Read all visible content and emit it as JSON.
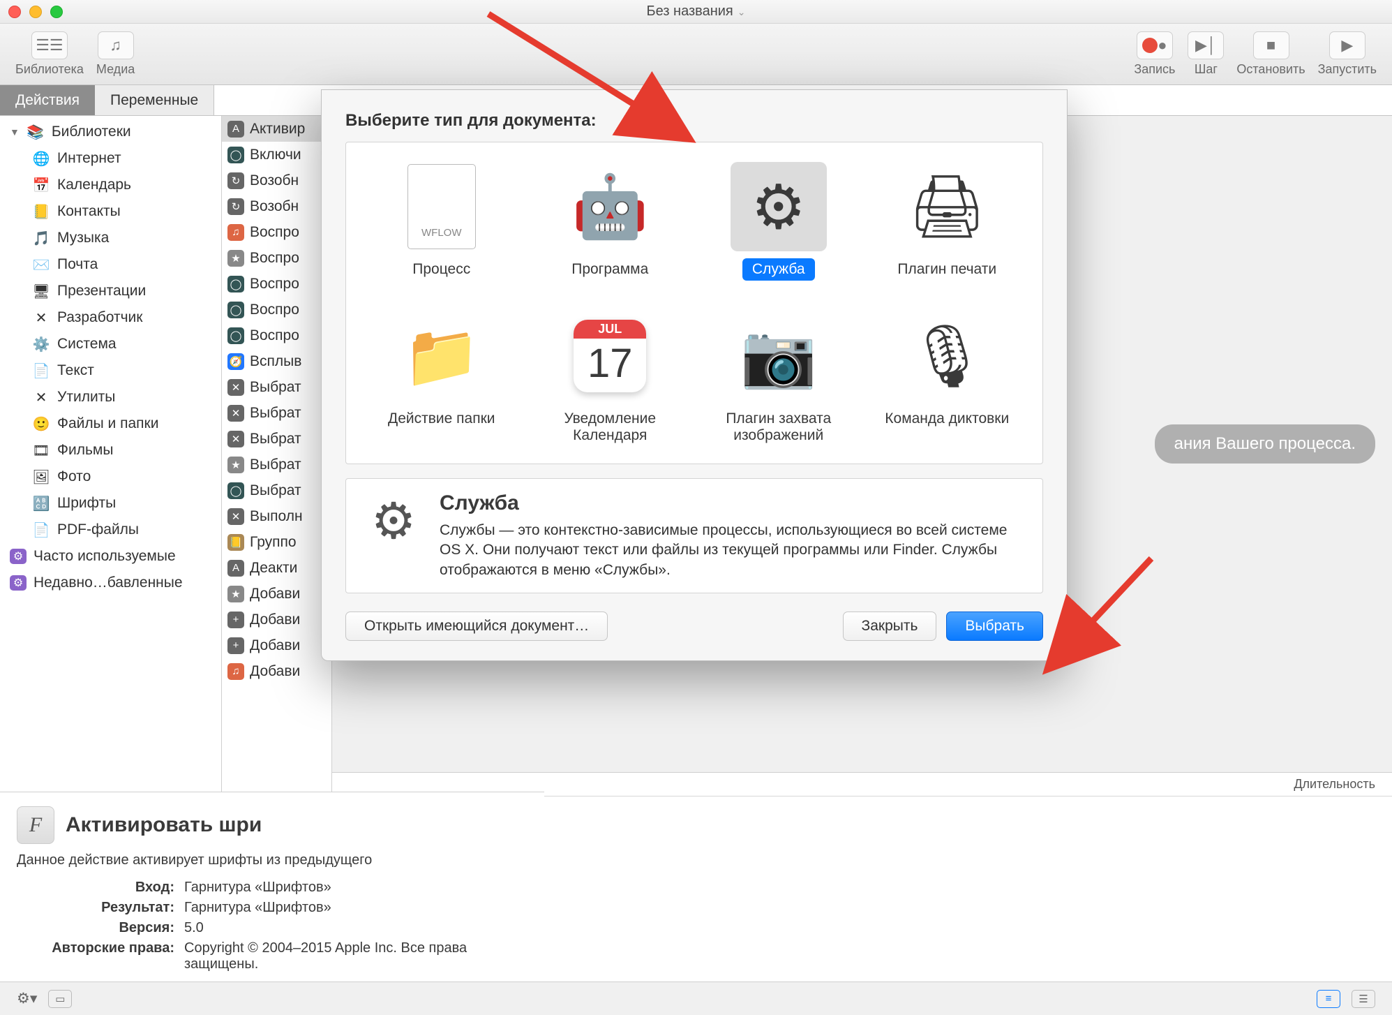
{
  "window": {
    "title": "Без названия"
  },
  "toolbar": {
    "left": [
      {
        "id": "library",
        "label": "Библиотека",
        "glyph": "☰☰"
      },
      {
        "id": "media",
        "label": "Медиа",
        "glyph": "♫"
      }
    ],
    "right": [
      {
        "id": "record",
        "label": "Запись",
        "glyph": "●"
      },
      {
        "id": "step",
        "label": "Шаг",
        "glyph": "▶│"
      },
      {
        "id": "stop",
        "label": "Остановить",
        "glyph": "■"
      },
      {
        "id": "run",
        "label": "Запустить",
        "glyph": "▶"
      }
    ]
  },
  "tabs": {
    "actions": "Действия",
    "variables": "Переменные"
  },
  "libraries": {
    "header": "Библиотеки",
    "items": [
      {
        "key": "internet",
        "label": "Интернет",
        "icon": "🌐"
      },
      {
        "key": "calendar",
        "label": "Календарь",
        "icon": "📅"
      },
      {
        "key": "contacts",
        "label": "Контакты",
        "icon": "📒"
      },
      {
        "key": "music",
        "label": "Музыка",
        "icon": "🎵"
      },
      {
        "key": "mail",
        "label": "Почта",
        "icon": "✉️"
      },
      {
        "key": "keynote",
        "label": "Презентации",
        "icon": "🖥"
      },
      {
        "key": "developer",
        "label": "Разработчик",
        "icon": "✕"
      },
      {
        "key": "system",
        "label": "Система",
        "icon": "⚙️"
      },
      {
        "key": "text",
        "label": "Текст",
        "icon": "📄"
      },
      {
        "key": "utilities",
        "label": "Утилиты",
        "icon": "✕"
      },
      {
        "key": "files",
        "label": "Файлы и папки",
        "icon": "🙂"
      },
      {
        "key": "movies",
        "label": "Фильмы",
        "icon": "🎞"
      },
      {
        "key": "photo",
        "label": "Фото",
        "icon": "🖼"
      },
      {
        "key": "fonts",
        "label": "Шрифты",
        "icon": "🔠"
      },
      {
        "key": "pdf",
        "label": "PDF-файлы",
        "icon": "📄"
      }
    ],
    "smart": [
      {
        "key": "popular",
        "label": "Часто используемые"
      },
      {
        "key": "recent",
        "label": "Недавно…бавленные"
      }
    ]
  },
  "actions_list": [
    {
      "label": "Активир",
      "sel": true,
      "c": "#666",
      "g": "A"
    },
    {
      "label": "Включи",
      "c": "#355",
      "g": "◯"
    },
    {
      "label": "Возобн",
      "c": "#666",
      "g": "↻"
    },
    {
      "label": "Возобн",
      "c": "#666",
      "g": "↻"
    },
    {
      "label": "Воспро",
      "c": "#d64",
      "g": "♫"
    },
    {
      "label": "Воспро",
      "c": "#888",
      "g": "★"
    },
    {
      "label": "Воспро",
      "c": "#355",
      "g": "◯"
    },
    {
      "label": "Воспро",
      "c": "#355",
      "g": "◯"
    },
    {
      "label": "Воспро",
      "c": "#355",
      "g": "◯"
    },
    {
      "label": "Всплыв",
      "c": "#27f",
      "g": "🧭"
    },
    {
      "label": "Выбрат",
      "c": "#666",
      "g": "✕"
    },
    {
      "label": "Выбрат",
      "c": "#666",
      "g": "✕"
    },
    {
      "label": "Выбрат",
      "c": "#666",
      "g": "✕"
    },
    {
      "label": "Выбрат",
      "c": "#888",
      "g": "★"
    },
    {
      "label": "Выбрат",
      "c": "#355",
      "g": "◯"
    },
    {
      "label": "Выполн",
      "c": "#666",
      "g": "✕"
    },
    {
      "label": "Группо",
      "c": "#a85",
      "g": "📒"
    },
    {
      "label": "Деакти",
      "c": "#666",
      "g": "A"
    },
    {
      "label": "Добави",
      "c": "#888",
      "g": "★"
    },
    {
      "label": "Добави",
      "c": "#666",
      "g": "+"
    },
    {
      "label": "Добави",
      "c": "#666",
      "g": "+"
    },
    {
      "label": "Добави",
      "c": "#d64",
      "g": "♫"
    }
  ],
  "sheet": {
    "prompt": "Выберите тип для документа:",
    "types": [
      {
        "key": "workflow",
        "label": "Процесс",
        "badge": "WFLOW"
      },
      {
        "key": "application",
        "label": "Программа"
      },
      {
        "key": "service",
        "label": "Служба",
        "selected": true
      },
      {
        "key": "printplugin",
        "label": "Плагин печати"
      },
      {
        "key": "folderaction",
        "label": "Действие папки"
      },
      {
        "key": "calalarm",
        "label": "Уведомление Календаря",
        "cal_month": "JUL",
        "cal_day": "17"
      },
      {
        "key": "imagecapture",
        "label": "Плагин захвата изображений"
      },
      {
        "key": "dictation",
        "label": "Команда диктовки"
      }
    ],
    "desc_title": "Служба",
    "desc_body": "Службы — это контекстно-зависимые процессы, использующиеся во всей системе OS X. Они получают текст или файлы из текущей программы или Finder. Службы отображаются в меню «Службы».",
    "open_existing": "Открыть имеющийся документ…",
    "close": "Закрыть",
    "choose": "Выбрать"
  },
  "info_panel": {
    "title": "Активировать шри",
    "subtitle": "Данное действие активирует шрифты из предыдущего",
    "meta": [
      {
        "label": "Вход:",
        "value": "Гарнитура «Шрифтов»"
      },
      {
        "label": "Результат:",
        "value": "Гарнитура «Шрифтов»"
      },
      {
        "label": "Версия:",
        "value": "5.0"
      },
      {
        "label": "Авторские права:",
        "value": "Copyright © 2004–2015 Apple Inc. Все права защищены."
      }
    ]
  },
  "canvas_hint": "ания Вашего процесса.",
  "timeline": {
    "duration_label": "Длительность"
  }
}
